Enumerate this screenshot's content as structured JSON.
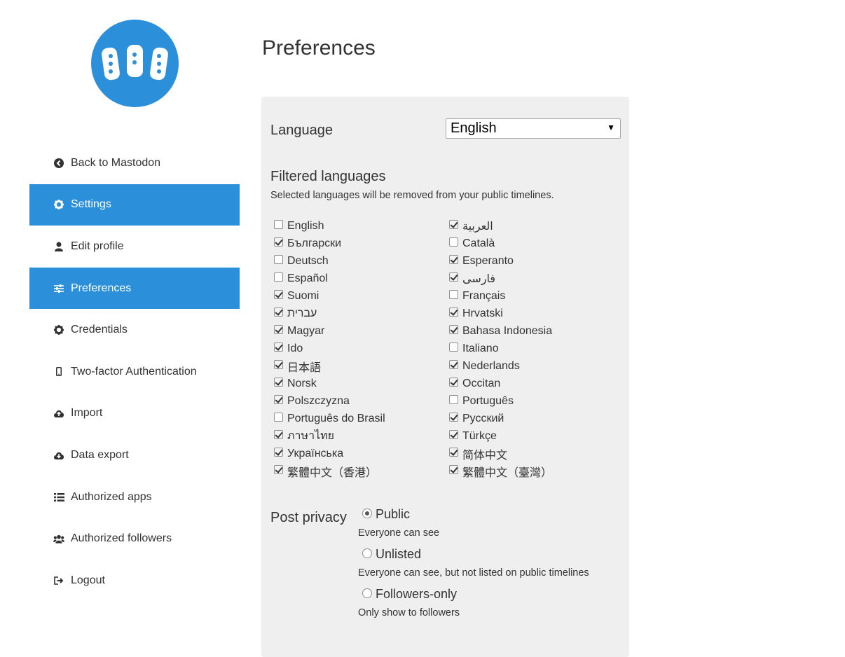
{
  "sidebar": {
    "items": [
      {
        "label": "Back to Mastodon",
        "icon": "chevron-circle-left-icon",
        "active": false
      },
      {
        "label": "Settings",
        "icon": "cog-icon",
        "active": true
      },
      {
        "label": "Edit profile",
        "icon": "user-icon",
        "active": false
      },
      {
        "label": "Preferences",
        "icon": "sliders-icon",
        "active": true
      },
      {
        "label": "Credentials",
        "icon": "cog-icon",
        "active": false
      },
      {
        "label": "Two-factor Authentication",
        "icon": "mobile-icon",
        "active": false
      },
      {
        "label": "Import",
        "icon": "cloud-upload-icon",
        "active": false
      },
      {
        "label": "Data export",
        "icon": "cloud-download-icon",
        "active": false
      },
      {
        "label": "Authorized apps",
        "icon": "list-icon",
        "active": false
      },
      {
        "label": "Authorized followers",
        "icon": "users-icon",
        "active": false
      },
      {
        "label": "Logout",
        "icon": "sign-out-icon",
        "active": false
      }
    ]
  },
  "main": {
    "title": "Preferences",
    "language": {
      "label": "Language",
      "selected": "English"
    },
    "filtered_languages": {
      "title": "Filtered languages",
      "hint": "Selected languages will be removed from your public timelines.",
      "left": [
        {
          "label": "English",
          "checked": false
        },
        {
          "label": "Български",
          "checked": true
        },
        {
          "label": "Deutsch",
          "checked": false
        },
        {
          "label": "Español",
          "checked": false
        },
        {
          "label": "Suomi",
          "checked": true
        },
        {
          "label": "עברית",
          "checked": true
        },
        {
          "label": "Magyar",
          "checked": true
        },
        {
          "label": "Ido",
          "checked": true
        },
        {
          "label": "日本語",
          "checked": true
        },
        {
          "label": "Norsk",
          "checked": true
        },
        {
          "label": "Polszczyzna",
          "checked": true
        },
        {
          "label": "Português do Brasil",
          "checked": false
        },
        {
          "label": "ภาษาไทย",
          "checked": true
        },
        {
          "label": "Українська",
          "checked": true
        },
        {
          "label": "繁體中文（香港）",
          "checked": true
        }
      ],
      "right": [
        {
          "label": "العربية",
          "checked": true
        },
        {
          "label": "Català",
          "checked": false
        },
        {
          "label": "Esperanto",
          "checked": true
        },
        {
          "label": "فارسی",
          "checked": true
        },
        {
          "label": "Français",
          "checked": false
        },
        {
          "label": "Hrvatski",
          "checked": true
        },
        {
          "label": "Bahasa Indonesia",
          "checked": true
        },
        {
          "label": "Italiano",
          "checked": false
        },
        {
          "label": "Nederlands",
          "checked": true
        },
        {
          "label": "Occitan",
          "checked": true
        },
        {
          "label": "Português",
          "checked": false
        },
        {
          "label": "Русский",
          "checked": true
        },
        {
          "label": "Türkçe",
          "checked": true
        },
        {
          "label": "简体中文",
          "checked": true
        },
        {
          "label": "繁體中文（臺灣）",
          "checked": true
        }
      ]
    },
    "post_privacy": {
      "label": "Post privacy",
      "options": [
        {
          "label": "Public",
          "hint": "Everyone can see",
          "selected": true
        },
        {
          "label": "Unlisted",
          "hint": "Everyone can see, but not listed on public timelines",
          "selected": false
        },
        {
          "label": "Followers-only",
          "hint": "Only show to followers",
          "selected": false
        }
      ]
    }
  },
  "colors": {
    "accent": "#2b90d9",
    "panel": "#efefef",
    "text": "#333333"
  }
}
